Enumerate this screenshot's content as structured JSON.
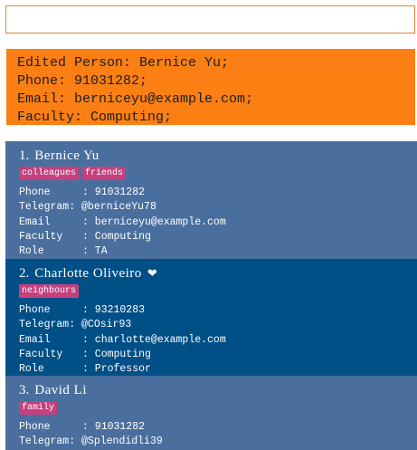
{
  "command_box": {
    "value": "",
    "placeholder": ""
  },
  "result": {
    "lines": [
      "Edited Person: Bernice Yu;",
      "Phone: 91031282;",
      "Email: berniceyu@example.com;",
      "Faculty: Computing;"
    ]
  },
  "persons": [
    {
      "index": "1.",
      "name": "Bernice Yu",
      "favourite": false,
      "tags": [
        "colleagues",
        "friends"
      ],
      "phone_label": "Phone",
      "phone": ": 91031282",
      "telegram_label": "Telegram:",
      "telegram": "@berniceYu78",
      "email_label": "Email",
      "email": ": berniceyu@example.com",
      "faculty_label": "Faculty",
      "faculty": ": Computing",
      "role_label": "Role",
      "role": ": TA"
    },
    {
      "index": "2.",
      "name": "Charlotte Oliveiro",
      "favourite": true,
      "heart": "❤",
      "tags": [
        "neighbours"
      ],
      "phone_label": "Phone",
      "phone": ": 93210283",
      "telegram_label": "Telegram:",
      "telegram": "@COsir93",
      "email_label": "Email",
      "email": ": charlotte@example.com",
      "faculty_label": "Faculty",
      "faculty": ": Computing",
      "role_label": "Role",
      "role": ": Professor"
    },
    {
      "index": "3.",
      "name": "David Li",
      "favourite": false,
      "tags": [
        "family"
      ],
      "phone_label": "Phone",
      "phone": ": 91031282",
      "telegram_label": "Telegram:",
      "telegram": "@Splendidli39"
    }
  ],
  "colors": {
    "result_background": "#fb7f13",
    "card_background": "#4a6f9e",
    "card_selected_background": "#004f87",
    "tag_background": "#c5407d",
    "command_border": "#e0883a"
  }
}
